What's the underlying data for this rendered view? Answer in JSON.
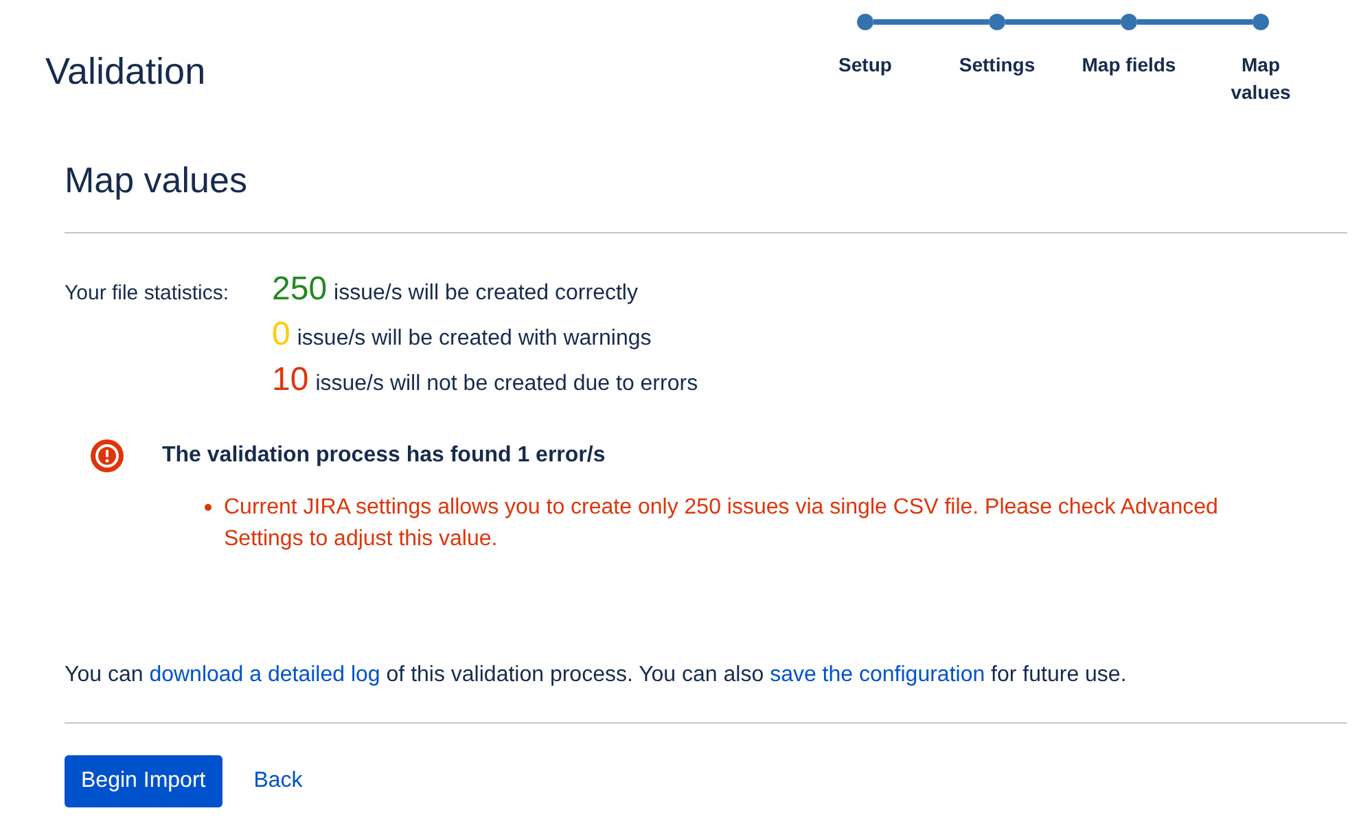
{
  "page_title": "Validation",
  "steps": [
    {
      "label": "Setup",
      "completed": true
    },
    {
      "label": "Settings",
      "completed": true
    },
    {
      "label": "Map fields",
      "completed": true
    },
    {
      "label": "Map values",
      "completed": true
    }
  ],
  "section_title": "Map values",
  "statistics": {
    "label": "Your file statistics:",
    "rows": [
      {
        "count": "250",
        "text": "issue/s will be created correctly",
        "color": "#23891f"
      },
      {
        "count": "0",
        "text": "issue/s will be created with warnings",
        "color": "#ffcc00"
      },
      {
        "count": "10",
        "text": "issue/s will not be created due to errors",
        "color": "#de350b"
      }
    ]
  },
  "error_panel": {
    "title": "The validation process has found 1 error/s",
    "errors": [
      "Current JIRA settings allows you to create only 250 issues via single CSV file. Please check Advanced Settings to adjust this value."
    ]
  },
  "footer_note": {
    "parts": [
      {
        "kind": "text",
        "text": "You can "
      },
      {
        "kind": "link",
        "text": "download a detailed log"
      },
      {
        "kind": "text",
        "text": " of this validation process. You can also "
      },
      {
        "kind": "link",
        "text": "save the configuration"
      },
      {
        "kind": "text",
        "text": " for future use."
      }
    ]
  },
  "buttons": [
    {
      "kind": "primary",
      "label": "Begin Import"
    },
    {
      "kind": "link",
      "label": "Back"
    }
  ]
}
